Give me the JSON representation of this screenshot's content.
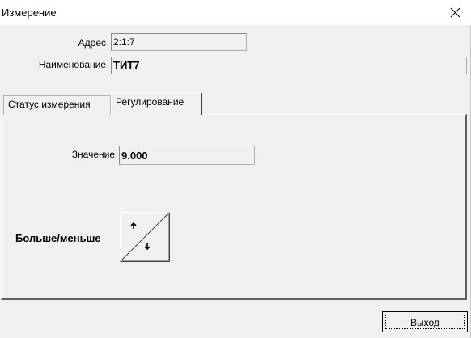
{
  "window": {
    "title": "Измерение",
    "close_glyph": "✕"
  },
  "fields": {
    "address": {
      "label": "Адрес",
      "value": "2:1:7"
    },
    "name": {
      "label": "Наименование",
      "value": "ТИТ7"
    }
  },
  "tabs": [
    {
      "label": "Статус измерения",
      "active": false
    },
    {
      "label": "Регулирование",
      "active": true
    }
  ],
  "regulation": {
    "value_label": "Значение",
    "value": "9.000",
    "more_less_label": "Больше/меньше",
    "up_glyph": "↑",
    "down_glyph": "↓"
  },
  "buttons": {
    "exit_label": "Выход"
  }
}
